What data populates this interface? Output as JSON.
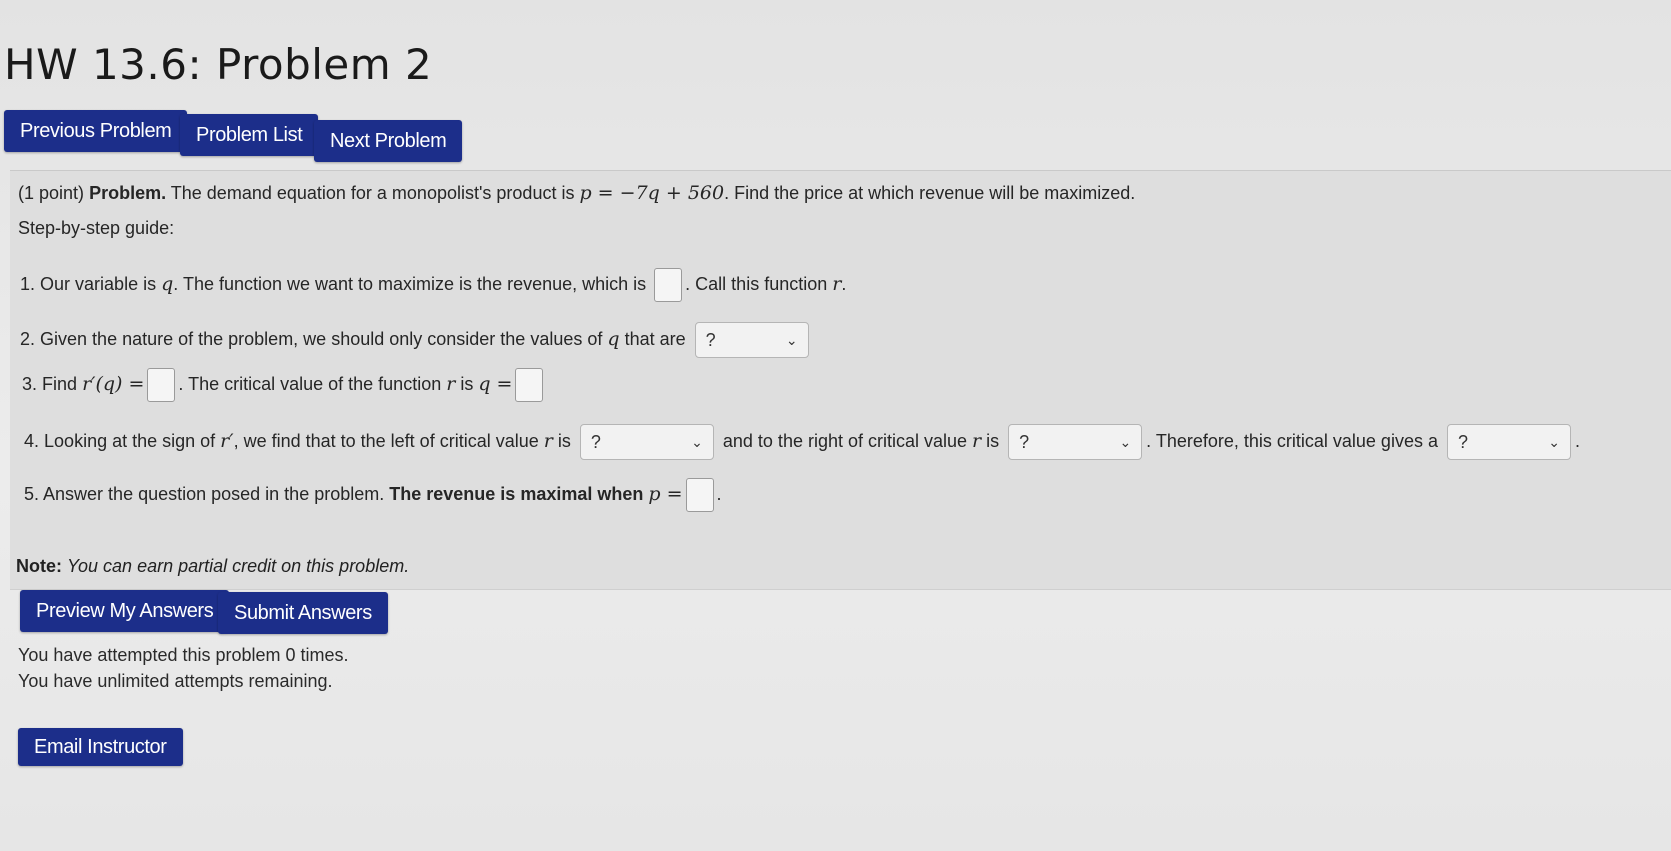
{
  "title": "HW 13.6: Problem 2",
  "nav": {
    "previous": "Previous Problem",
    "list": "Problem List",
    "next": "Next Problem"
  },
  "problem": {
    "points": "(1 point)",
    "label": "Problem.",
    "text_before": "The demand equation for a monopolist's product is",
    "equation": "p = −7q + 560",
    "text_after": ". Find the price at which revenue will be maximized.",
    "guide": "Step-by-step guide:",
    "steps": [
      {
        "num": "1.",
        "a": "Our variable is",
        "var": "q",
        "b": ". The function we want to maximize is the revenue, which is",
        "c": ". Call this function",
        "fn": "r",
        "d": "."
      },
      {
        "num": "2.",
        "a": "Given the nature of the problem, we should only consider the values of",
        "var": "q",
        "b": "that are",
        "select": "?"
      },
      {
        "num": "3.",
        "a": "Find",
        "deriv": "r′(q) =",
        "b": ". The critical value of the function",
        "fn": "r",
        "c": "is",
        "qeq": "q ="
      },
      {
        "num": "4.",
        "a": "Looking at the sign of",
        "fnp": "r′",
        "b": ", we find that to the left of critical value",
        "fn": "r",
        "c": "is",
        "select1": "?",
        "d": "and to the right of critical value",
        "e": "is",
        "select2": "?",
        "f": ". Therefore, this critical value gives a",
        "select3": "?",
        "g": "."
      },
      {
        "num": "5.",
        "a": "Answer the question posed in the problem.",
        "b": "The revenue is maximal when",
        "peq": "p =",
        "c": "."
      }
    ]
  },
  "note": {
    "label": "Note:",
    "text": "You can earn partial credit on this problem."
  },
  "actions": {
    "preview": "Preview My Answers",
    "submit": "Submit Answers",
    "email": "Email Instructor"
  },
  "attempts": {
    "line1": "You have attempted this problem 0 times.",
    "line2": "You have unlimited attempts remaining."
  },
  "colors": {
    "button": "#1c2e8a",
    "problem_background": "#dedede"
  }
}
